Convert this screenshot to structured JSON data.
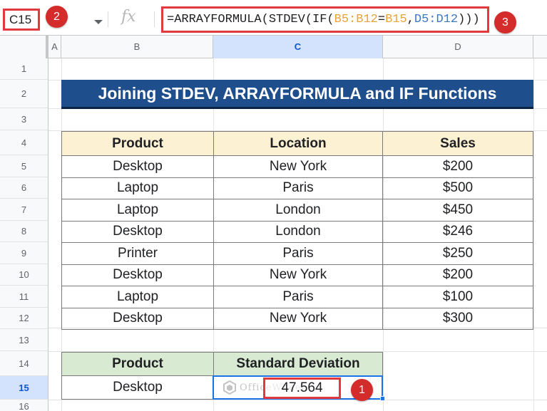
{
  "formula_bar": {
    "cell_ref": "C15",
    "fx_symbol": "fx",
    "formula_parts": [
      "=ARRAYFORMULA(STDEV(IF(",
      "B5:B12",
      "=",
      "B15",
      ",",
      "D5:D12",
      ")))"
    ]
  },
  "badges": [
    "1",
    "2",
    "3"
  ],
  "columns": [
    "A",
    "B",
    "C",
    "D"
  ],
  "rows": [
    "1",
    "2",
    "3",
    "4",
    "5",
    "6",
    "7",
    "8",
    "9",
    "10",
    "11",
    "12",
    "13",
    "14",
    "15",
    "16"
  ],
  "active_column": "C",
  "active_row": "15",
  "title": "Joining STDEV, ARRAYFORMULA and IF Functions",
  "main_table": {
    "headers": [
      "Product",
      "Location",
      "Sales"
    ],
    "rows": [
      [
        "Desktop",
        "New York",
        "$200"
      ],
      [
        "Laptop",
        "Paris",
        "$500"
      ],
      [
        "Laptop",
        "London",
        "$450"
      ],
      [
        "Desktop",
        "London",
        "$246"
      ],
      [
        "Printer",
        "Paris",
        "$250"
      ],
      [
        "Desktop",
        "New York",
        "$200"
      ],
      [
        "Laptop",
        "Paris",
        "$100"
      ],
      [
        "Desktop",
        "New York",
        "$300"
      ]
    ]
  },
  "result_table": {
    "headers": [
      "Product",
      "Standard Deviation"
    ],
    "product": "Desktop",
    "value": "47.564"
  },
  "watermark": "OfficeWheel",
  "colors": {
    "banner": "#1f4e8c",
    "header_fill": "#fdf1d3",
    "result_header_fill": "#d9ead3",
    "highlight": "#e0393e",
    "selection": "#1a73e8"
  }
}
